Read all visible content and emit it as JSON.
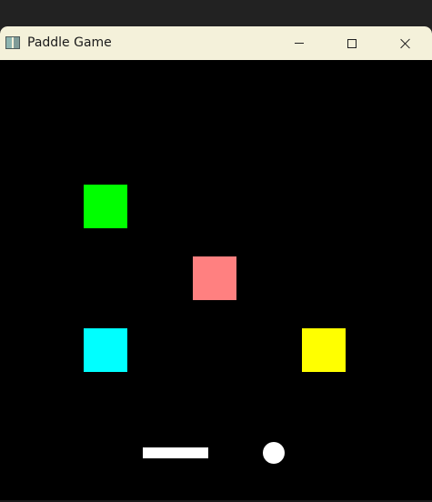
{
  "window": {
    "title": "Paddle Game",
    "icon": "window-app-icon",
    "controls": [
      {
        "name": "minimize",
        "icon": "minimize-icon"
      },
      {
        "name": "maximize",
        "icon": "maximize-icon"
      },
      {
        "name": "close",
        "icon": "close-icon"
      }
    ]
  },
  "game": {
    "background_color": "#000000",
    "blocks": [
      {
        "id": "block-1",
        "color": "#00ff00"
      },
      {
        "id": "block-2",
        "color": "#ff8080"
      },
      {
        "id": "block-3",
        "color": "#00ffff"
      },
      {
        "id": "block-4",
        "color": "#ffff00"
      }
    ],
    "paddle": {
      "color": "#ffffff"
    },
    "ball": {
      "color": "#ffffff"
    }
  },
  "colors": {
    "titlebar": "#f4f1da",
    "title_text": "#1a1a1a",
    "controls": "#202020"
  }
}
